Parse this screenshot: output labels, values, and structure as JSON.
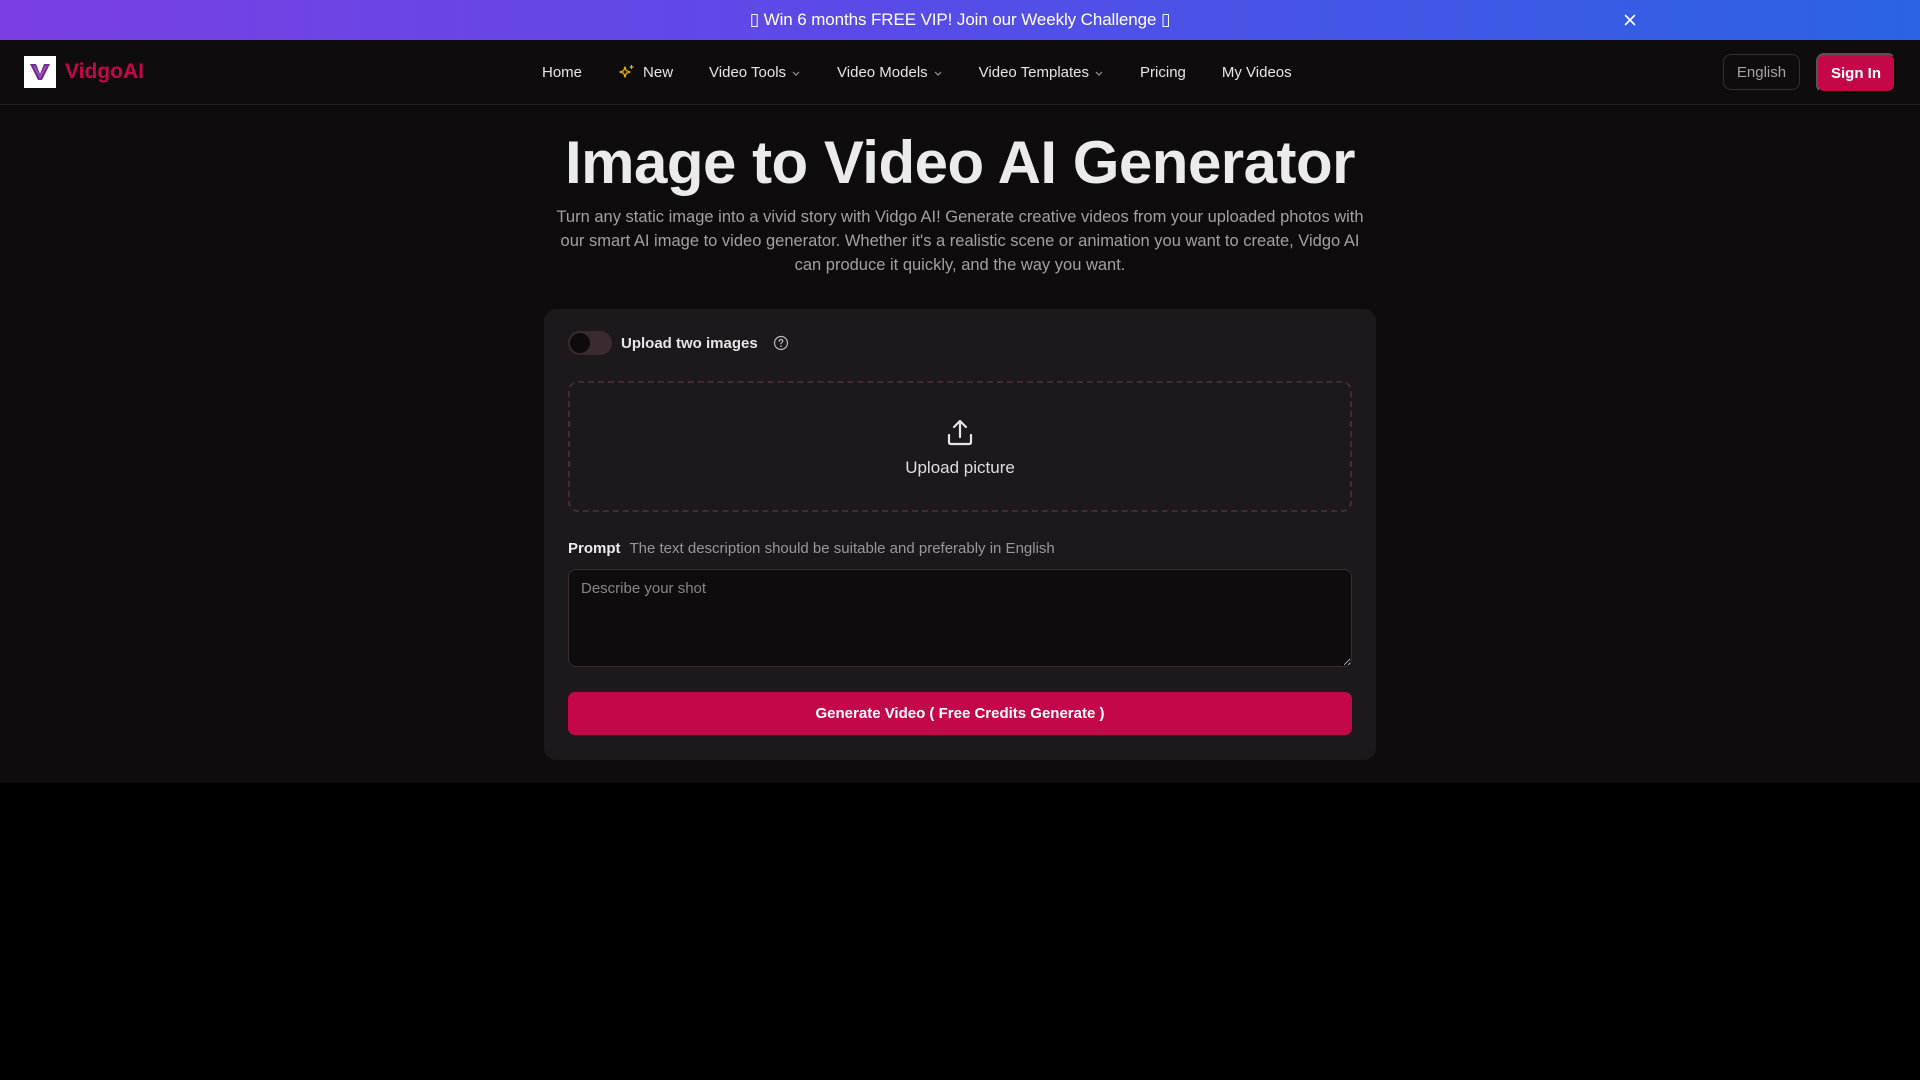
{
  "promo": {
    "text": "▯ Win 6 months FREE VIP! Join our Weekly Challenge ▯",
    "close_icon": "close-icon"
  },
  "header": {
    "logo_text": "VidgoAI",
    "nav": [
      {
        "label": "Home"
      },
      {
        "label": "New",
        "icon": "sparkle-icon"
      },
      {
        "label": "Video Tools",
        "icon": "chevron-down-icon"
      },
      {
        "label": "Video Models",
        "icon": "chevron-down-icon"
      },
      {
        "label": "Video Templates",
        "icon": "chevron-down-icon"
      },
      {
        "label": "Pricing"
      },
      {
        "label": "My Videos"
      }
    ],
    "language": "English",
    "sign_in": "Sign In"
  },
  "hero": {
    "title": "Image to Video AI Generator",
    "subtitle": "Turn any static image into a vivid story with Vidgo AI! Generate creative videos from your uploaded photos with our smart AI image to video generator. Whether it's a realistic scene or animation you want to create, Vidgo AI can produce it quickly, and the way you want."
  },
  "form": {
    "toggle_label": "Upload two images",
    "toggle_on": false,
    "upload_label": "Upload picture",
    "prompt_label": "Prompt",
    "prompt_hint": "The text description should be suitable and preferably in English",
    "prompt_value": "",
    "prompt_placeholder": "Describe your shot",
    "generate_label": "Generate Video ( Free Credits Generate )"
  },
  "colors": {
    "accent": "#c4074a",
    "background": "#0e0c0d",
    "card": "#1d181c"
  }
}
